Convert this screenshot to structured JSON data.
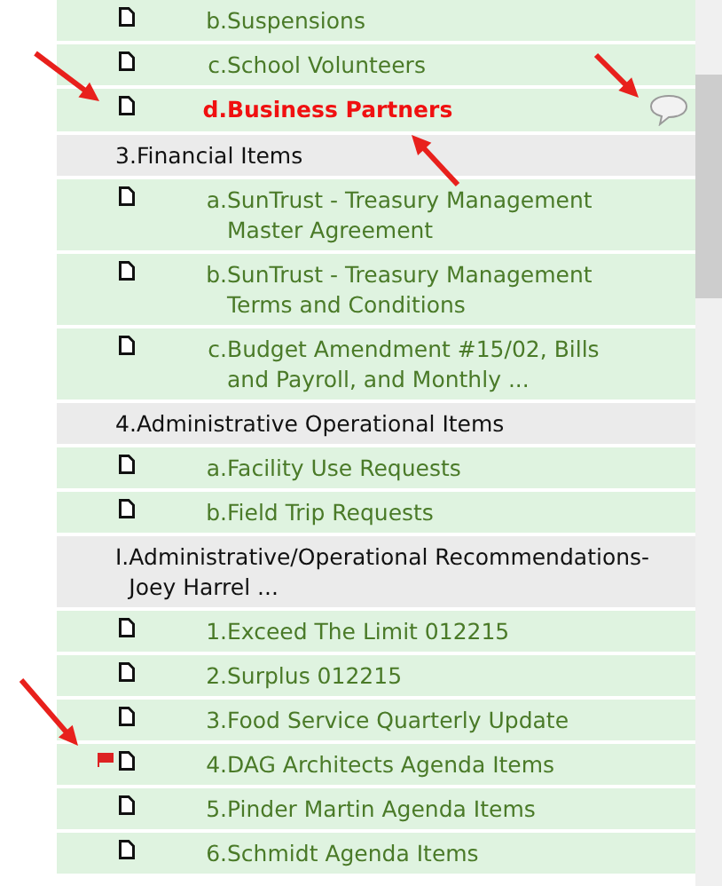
{
  "agenda_items": [
    {
      "kind": "document",
      "marker": "b.",
      "label": "Suspensions",
      "current": false,
      "flagged": false,
      "comment": false
    },
    {
      "kind": "document",
      "marker": "c.",
      "label": "School Volunteers",
      "current": false,
      "flagged": false,
      "comment": false
    },
    {
      "kind": "document",
      "marker": "d.",
      "label": "Business Partners",
      "current": true,
      "flagged": false,
      "comment": true
    },
    {
      "kind": "section",
      "marker": "3.",
      "label": "Financial Items"
    },
    {
      "kind": "document",
      "marker": "a.",
      "label": "SunTrust - Treasury Management Master Agreement",
      "current": false,
      "flagged": false,
      "comment": false
    },
    {
      "kind": "document",
      "marker": "b.",
      "label": "SunTrust - Treasury Management Terms and Conditions",
      "current": false,
      "flagged": false,
      "comment": false
    },
    {
      "kind": "document",
      "marker": "c.",
      "label": "Budget Amendment #15/02, Bills and Payroll, and Monthly ...",
      "current": false,
      "flagged": false,
      "comment": false
    },
    {
      "kind": "section",
      "marker": "4.",
      "label": "Administrative Operational Items"
    },
    {
      "kind": "document",
      "marker": "a.",
      "label": "Facility Use Requests",
      "current": false,
      "flagged": false,
      "comment": false
    },
    {
      "kind": "document",
      "marker": "b.",
      "label": "Field Trip Requests",
      "current": false,
      "flagged": false,
      "comment": false
    },
    {
      "kind": "section",
      "marker": "I.",
      "label": "Administrative/Operational Recommendations- Joey Harrel ..."
    },
    {
      "kind": "document",
      "marker": "1.",
      "label": "Exceed The Limit 012215",
      "current": false,
      "flagged": false,
      "comment": false
    },
    {
      "kind": "document",
      "marker": "2.",
      "label": "Surplus 012215",
      "current": false,
      "flagged": false,
      "comment": false
    },
    {
      "kind": "document",
      "marker": "3.",
      "label": "Food Service Quarterly Update",
      "current": false,
      "flagged": false,
      "comment": false
    },
    {
      "kind": "document",
      "marker": "4.",
      "label": "DAG Architects Agenda Items",
      "current": false,
      "flagged": true,
      "comment": false
    },
    {
      "kind": "document",
      "marker": "5.",
      "label": "Pinder Martin Agenda Items",
      "current": false,
      "flagged": false,
      "comment": false
    },
    {
      "kind": "document",
      "marker": "6.",
      "label": "Schmidt Agenda Items",
      "current": false,
      "flagged": false,
      "comment": false
    }
  ]
}
